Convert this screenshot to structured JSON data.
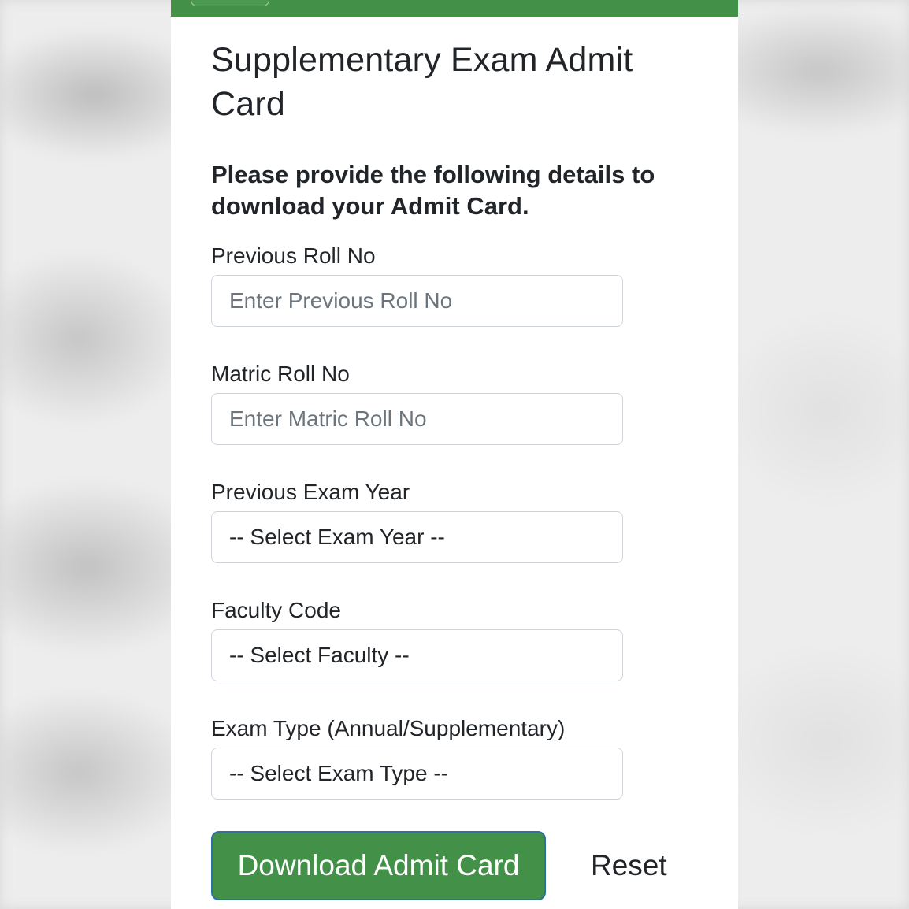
{
  "header": {
    "title": "Supplementary Exam Admit Card",
    "brand_color": "#439048"
  },
  "form": {
    "instruction": "Please provide the following details to download your Admit Card.",
    "fields": [
      {
        "label": "Previous Roll No",
        "type": "input",
        "value": "",
        "placeholder": "Enter Previous Roll No"
      },
      {
        "label": "Matric Roll No",
        "type": "input",
        "value": "",
        "placeholder": "Enter Matric Roll No"
      },
      {
        "label": "Previous Exam Year",
        "type": "select",
        "selected": "-- Select Exam Year --"
      },
      {
        "label": "Faculty Code",
        "type": "select",
        "selected": "-- Select Faculty --"
      },
      {
        "label": "Exam Type (Annual/Supplementary)",
        "type": "select",
        "selected": "-- Select Exam Type --"
      }
    ]
  },
  "actions": {
    "download_label": "Download Admit Card",
    "reset_label": "Reset"
  }
}
